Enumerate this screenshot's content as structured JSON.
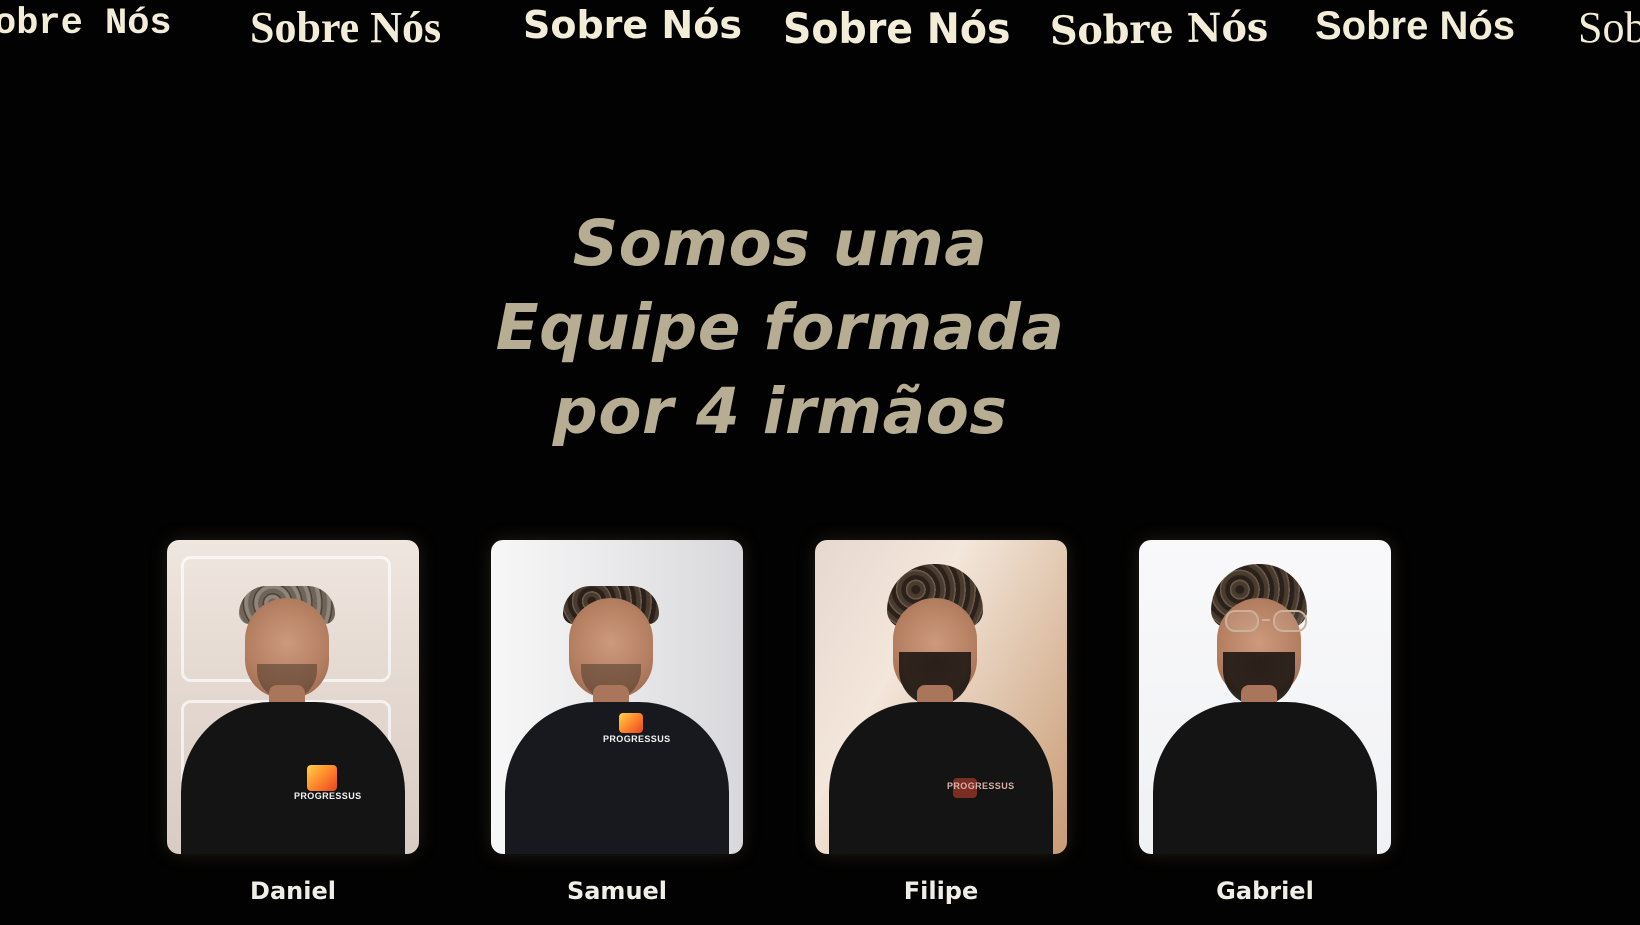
{
  "marquee": {
    "items": [
      "obre Nós",
      "Sobre Nós",
      "Sobre Nós",
      "Sobre Nós",
      "Sobre Nós",
      "Sobre Nós",
      "Sob"
    ]
  },
  "hero": {
    "line1": "Somos uma",
    "line2": "Equipe formada",
    "line3": "por 4 irmãos"
  },
  "team": [
    {
      "name": "Daniel",
      "photo_icon": "portrait-photo-icon",
      "logo_text": "PROGRESSUS"
    },
    {
      "name": "Samuel",
      "photo_icon": "portrait-photo-icon",
      "logo_text": "PROGRESSUS"
    },
    {
      "name": "Filipe",
      "photo_icon": "portrait-photo-icon",
      "logo_text": "PROGRESSUS"
    },
    {
      "name": "Gabriel",
      "photo_icon": "portrait-photo-icon"
    }
  ],
  "colors": {
    "background": "#020202",
    "headline": "#b7ad93",
    "marquee": "#f3ecd7",
    "names": "#f1eee7"
  }
}
